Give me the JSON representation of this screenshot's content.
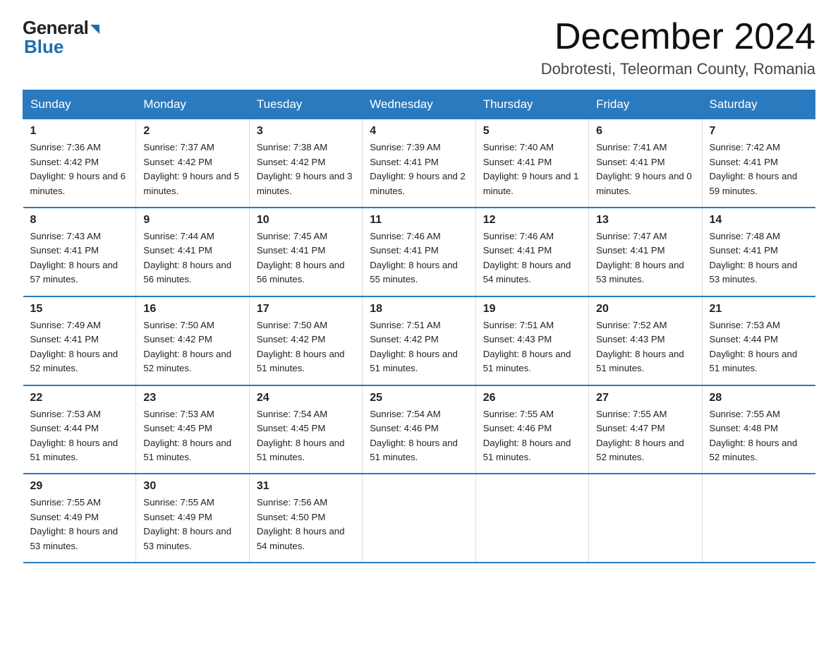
{
  "header": {
    "logo_text1": "General",
    "logo_text2": "Blue",
    "month_year": "December 2024",
    "location": "Dobrotesti, Teleorman County, Romania"
  },
  "weekdays": [
    "Sunday",
    "Monday",
    "Tuesday",
    "Wednesday",
    "Thursday",
    "Friday",
    "Saturday"
  ],
  "weeks": [
    [
      {
        "day": "1",
        "sunrise": "7:36 AM",
        "sunset": "4:42 PM",
        "daylight": "9 hours and 6 minutes."
      },
      {
        "day": "2",
        "sunrise": "7:37 AM",
        "sunset": "4:42 PM",
        "daylight": "9 hours and 5 minutes."
      },
      {
        "day": "3",
        "sunrise": "7:38 AM",
        "sunset": "4:42 PM",
        "daylight": "9 hours and 3 minutes."
      },
      {
        "day": "4",
        "sunrise": "7:39 AM",
        "sunset": "4:41 PM",
        "daylight": "9 hours and 2 minutes."
      },
      {
        "day": "5",
        "sunrise": "7:40 AM",
        "sunset": "4:41 PM",
        "daylight": "9 hours and 1 minute."
      },
      {
        "day": "6",
        "sunrise": "7:41 AM",
        "sunset": "4:41 PM",
        "daylight": "9 hours and 0 minutes."
      },
      {
        "day": "7",
        "sunrise": "7:42 AM",
        "sunset": "4:41 PM",
        "daylight": "8 hours and 59 minutes."
      }
    ],
    [
      {
        "day": "8",
        "sunrise": "7:43 AM",
        "sunset": "4:41 PM",
        "daylight": "8 hours and 57 minutes."
      },
      {
        "day": "9",
        "sunrise": "7:44 AM",
        "sunset": "4:41 PM",
        "daylight": "8 hours and 56 minutes."
      },
      {
        "day": "10",
        "sunrise": "7:45 AM",
        "sunset": "4:41 PM",
        "daylight": "8 hours and 56 minutes."
      },
      {
        "day": "11",
        "sunrise": "7:46 AM",
        "sunset": "4:41 PM",
        "daylight": "8 hours and 55 minutes."
      },
      {
        "day": "12",
        "sunrise": "7:46 AM",
        "sunset": "4:41 PM",
        "daylight": "8 hours and 54 minutes."
      },
      {
        "day": "13",
        "sunrise": "7:47 AM",
        "sunset": "4:41 PM",
        "daylight": "8 hours and 53 minutes."
      },
      {
        "day": "14",
        "sunrise": "7:48 AM",
        "sunset": "4:41 PM",
        "daylight": "8 hours and 53 minutes."
      }
    ],
    [
      {
        "day": "15",
        "sunrise": "7:49 AM",
        "sunset": "4:41 PM",
        "daylight": "8 hours and 52 minutes."
      },
      {
        "day": "16",
        "sunrise": "7:50 AM",
        "sunset": "4:42 PM",
        "daylight": "8 hours and 52 minutes."
      },
      {
        "day": "17",
        "sunrise": "7:50 AM",
        "sunset": "4:42 PM",
        "daylight": "8 hours and 51 minutes."
      },
      {
        "day": "18",
        "sunrise": "7:51 AM",
        "sunset": "4:42 PM",
        "daylight": "8 hours and 51 minutes."
      },
      {
        "day": "19",
        "sunrise": "7:51 AM",
        "sunset": "4:43 PM",
        "daylight": "8 hours and 51 minutes."
      },
      {
        "day": "20",
        "sunrise": "7:52 AM",
        "sunset": "4:43 PM",
        "daylight": "8 hours and 51 minutes."
      },
      {
        "day": "21",
        "sunrise": "7:53 AM",
        "sunset": "4:44 PM",
        "daylight": "8 hours and 51 minutes."
      }
    ],
    [
      {
        "day": "22",
        "sunrise": "7:53 AM",
        "sunset": "4:44 PM",
        "daylight": "8 hours and 51 minutes."
      },
      {
        "day": "23",
        "sunrise": "7:53 AM",
        "sunset": "4:45 PM",
        "daylight": "8 hours and 51 minutes."
      },
      {
        "day": "24",
        "sunrise": "7:54 AM",
        "sunset": "4:45 PM",
        "daylight": "8 hours and 51 minutes."
      },
      {
        "day": "25",
        "sunrise": "7:54 AM",
        "sunset": "4:46 PM",
        "daylight": "8 hours and 51 minutes."
      },
      {
        "day": "26",
        "sunrise": "7:55 AM",
        "sunset": "4:46 PM",
        "daylight": "8 hours and 51 minutes."
      },
      {
        "day": "27",
        "sunrise": "7:55 AM",
        "sunset": "4:47 PM",
        "daylight": "8 hours and 52 minutes."
      },
      {
        "day": "28",
        "sunrise": "7:55 AM",
        "sunset": "4:48 PM",
        "daylight": "8 hours and 52 minutes."
      }
    ],
    [
      {
        "day": "29",
        "sunrise": "7:55 AM",
        "sunset": "4:49 PM",
        "daylight": "8 hours and 53 minutes."
      },
      {
        "day": "30",
        "sunrise": "7:55 AM",
        "sunset": "4:49 PM",
        "daylight": "8 hours and 53 minutes."
      },
      {
        "day": "31",
        "sunrise": "7:56 AM",
        "sunset": "4:50 PM",
        "daylight": "8 hours and 54 minutes."
      },
      null,
      null,
      null,
      null
    ]
  ],
  "labels": {
    "sunrise": "Sunrise:",
    "sunset": "Sunset:",
    "daylight": "Daylight:"
  }
}
